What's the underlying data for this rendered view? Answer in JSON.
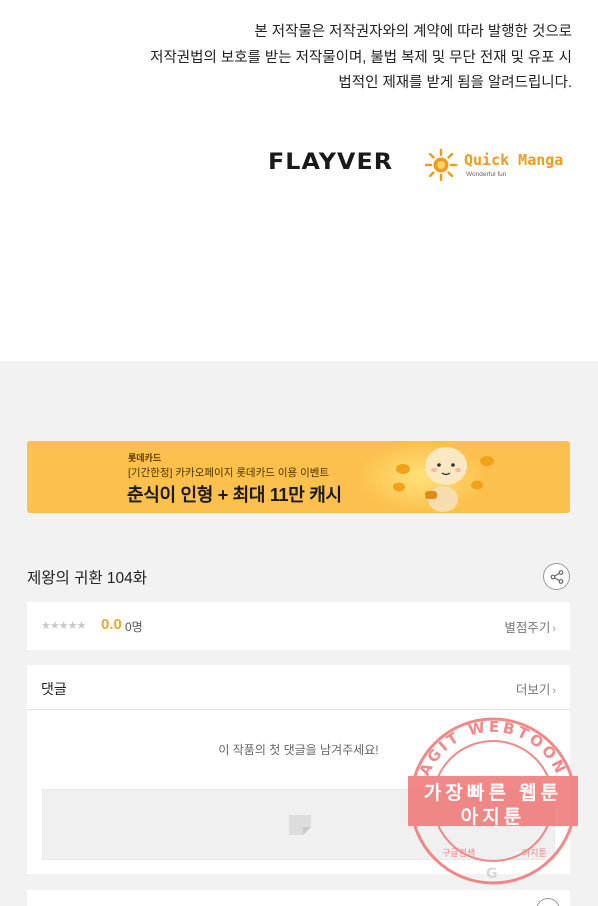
{
  "notice": {
    "line1": "본 저작물은 저작권자와의 계약에 따라 발행한 것으로",
    "line2": "저작권법의 보호를 받는 저작물이며, 불법 복제 및 무단 전재 및 유포 시",
    "line3": "법적인 제재를 받게 됨을 알려드립니다."
  },
  "logos": {
    "flayver": "FLAYVER",
    "quick_manga": "Quick Manga",
    "quick_manga_sub": "Wonderful fun"
  },
  "banner": {
    "brand": "롯데카드",
    "sub": "[기간한정] 카카오페이지 롯데카드 이용 이벤트",
    "headline": "춘식이 인형 + 최대 11만 캐시"
  },
  "episode": {
    "title": "제왕의 귀환 104화",
    "share_icon": "share-icon"
  },
  "rating": {
    "stars": "★★★★★",
    "score": "0.0",
    "count": "0명",
    "rate_link": "별점주기"
  },
  "comments": {
    "title": "댓글",
    "more_link": "더보기",
    "empty_message": "이 작품의 첫 댓글을 남겨주세요!"
  },
  "watermark": {
    "arc_text": "AGIT WEBTOON",
    "line1": "가장빠른 웹툰",
    "line2": "아지툰",
    "bottom_left": "구글검색",
    "bottom_right": "아지툰"
  },
  "colors": {
    "accent_score": "#f5a623",
    "banner_bg": "#fcc04c",
    "watermark": "#f07070"
  }
}
